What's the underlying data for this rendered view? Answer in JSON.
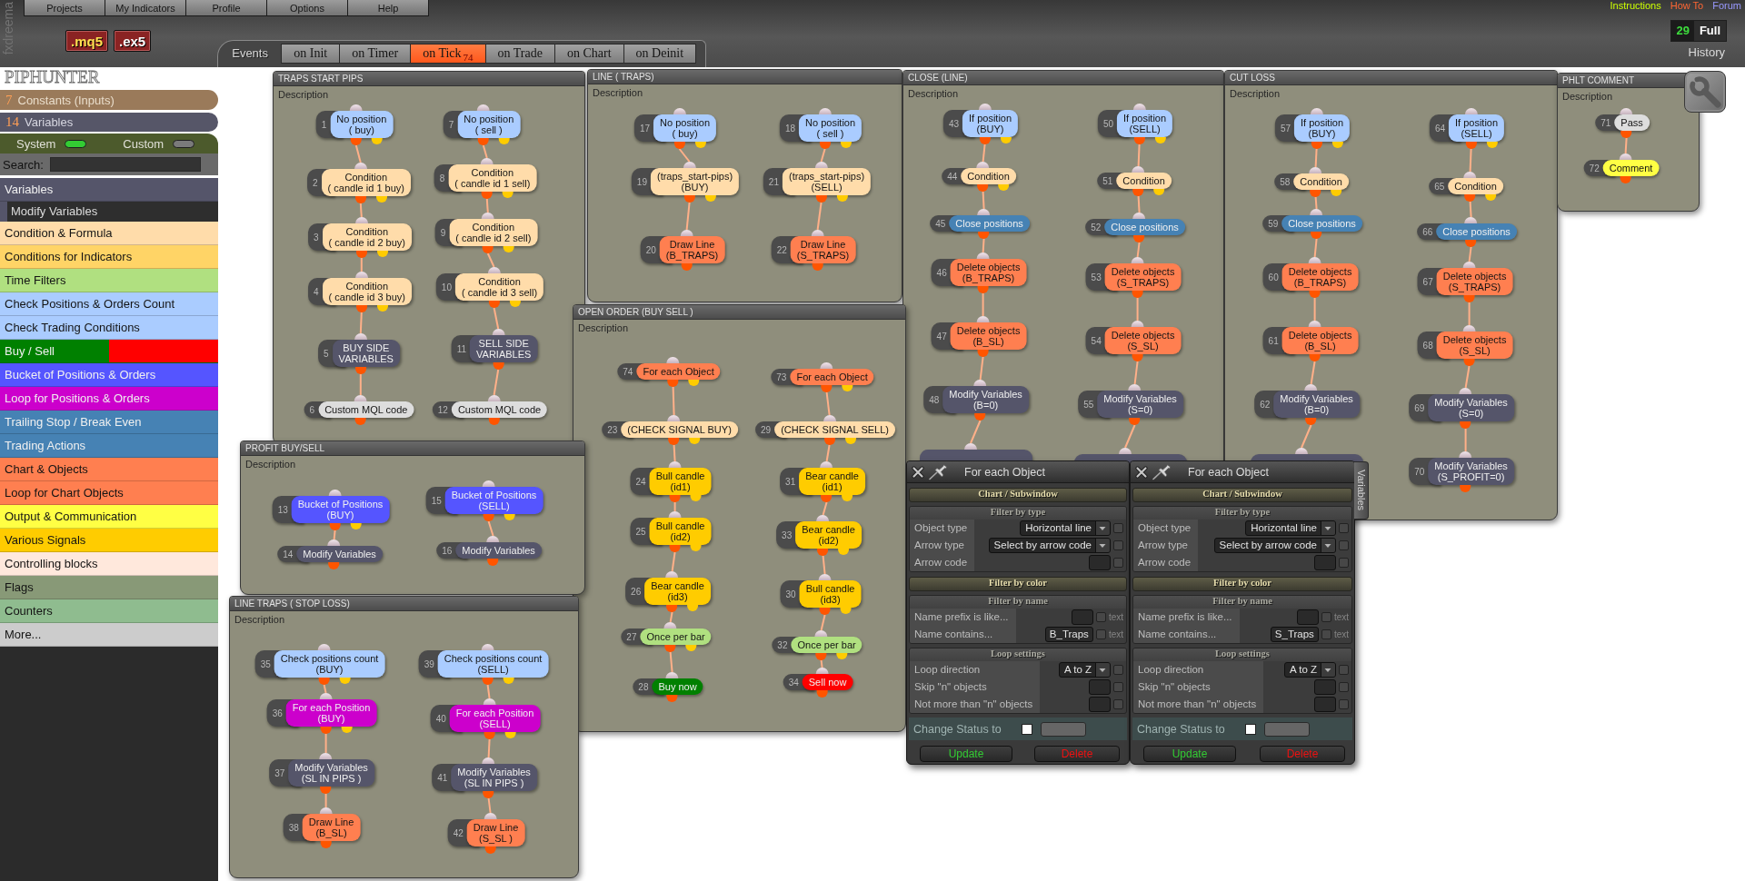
{
  "brand": "fxdreema",
  "menu": [
    "Projects",
    "My Indicators",
    "Profile",
    "Options",
    "Help"
  ],
  "export_buttons": [
    {
      "label": ".mq5",
      "kind": "source"
    },
    {
      "label": ".ex5",
      "kind": "compiled"
    }
  ],
  "events": {
    "label": "Events",
    "tabs": [
      {
        "label": "on Init",
        "selected": false
      },
      {
        "label": "on Timer",
        "selected": false
      },
      {
        "label": "on Tick",
        "count": "74",
        "selected": true
      },
      {
        "label": "on Trade",
        "selected": false
      },
      {
        "label": "on Chart",
        "selected": false
      },
      {
        "label": "on Deinit",
        "selected": false
      }
    ]
  },
  "links": [
    {
      "label": "Instructions",
      "color": "#ccff00"
    },
    {
      "label": "How To",
      "color": "#ff6633"
    },
    {
      "label": "Forum",
      "color": "#9999ff"
    }
  ],
  "block_counter": {
    "count": "29",
    "label": "Full"
  },
  "history": "History",
  "sidebar": {
    "project": "PIPHUNTER",
    "constants": {
      "count": "7",
      "label": "Constants (Inputs)"
    },
    "variables": {
      "count": "14",
      "label": "Variables"
    },
    "toggles": [
      {
        "label": "System",
        "on": true
      },
      {
        "label": "Custom",
        "on": false
      }
    ],
    "search": {
      "label": "Search:"
    },
    "categories": [
      {
        "label": "Variables",
        "color": "#55556a",
        "children": [
          {
            "label": "Modify Variables"
          }
        ]
      },
      {
        "label": "Condition & Formula",
        "color": "#ffdcaa"
      },
      {
        "label": "Conditions for Indicators",
        "color": "#ffd466"
      },
      {
        "label": "Time Filters",
        "color": "#b0e080"
      },
      {
        "label": "Check Positions & Orders Count",
        "color": "#aaccff"
      },
      {
        "label": "Check Trading Conditions",
        "color": "#aaccff"
      },
      {
        "label": "Buy / Sell",
        "color": "#008000",
        "split": {
          "color": "#ff0000"
        }
      },
      {
        "label": "Bucket of Positions & Orders",
        "color": "#5555ff"
      },
      {
        "label": "Loop for Positions & Orders",
        "color": "#cc00cc"
      },
      {
        "label": "Trailing Stop / Break Even",
        "color": "#4682b4"
      },
      {
        "label": "Trading Actions",
        "color": "#4682b4"
      },
      {
        "label": "Chart & Objects",
        "color": "#ff7f50"
      },
      {
        "label": "Loop for Chart Objects",
        "color": "#ff7f50"
      },
      {
        "label": "Output & Communication",
        "color": "#ffff44"
      },
      {
        "label": "Various Signals",
        "color": "#ffcc00"
      },
      {
        "label": "Controlling blocks",
        "color": "#ffe8dc"
      },
      {
        "label": "Flags",
        "color": "#889977"
      },
      {
        "label": "Counters",
        "color": "#8fbc8f"
      },
      {
        "label": "More...",
        "color": "#cccccc"
      }
    ]
  },
  "canvas": {
    "panels": [
      {
        "title": "TRAPS START PIPS",
        "description": "Description",
        "columns": [
          [
            {
              "number": "1",
              "label": "No position\n( buy)",
              "kind": "condition",
              "color": "#aaccff"
            },
            {
              "number": "2",
              "label": "Condition\n( candle id 1 buy)",
              "kind": "condition",
              "color": "#ffdcaa"
            },
            {
              "number": "3",
              "label": "Condition\n( candle id 2 buy)",
              "kind": "condition",
              "color": "#ffdcaa"
            },
            {
              "number": "4",
              "label": "Condition\n( candle id 3 buy)",
              "kind": "condition",
              "color": "#ffdcaa"
            },
            {
              "number": "5",
              "label": "BUY SIDE\nVARIABLES",
              "kind": "action",
              "color": "#55556a"
            },
            {
              "number": "6",
              "label": "Custom MQL code",
              "kind": "action",
              "color": "#dddddd"
            }
          ],
          [
            {
              "number": "7",
              "label": "No position\n( sell )",
              "kind": "condition",
              "color": "#aaccff"
            },
            {
              "number": "8",
              "label": "Condition\n( candle id 1 sell)",
              "kind": "condition",
              "color": "#ffdcaa"
            },
            {
              "number": "9",
              "label": "Condition\n( candle id 2 sell)",
              "kind": "condition",
              "color": "#ffdcaa"
            },
            {
              "number": "10",
              "label": "Condition\n( candle id 3 sell)",
              "kind": "condition",
              "color": "#ffdcaa"
            },
            {
              "number": "11",
              "label": "SELL SIDE\nVARIABLES",
              "kind": "action",
              "color": "#55556a"
            },
            {
              "number": "12",
              "label": "Custom MQL code",
              "kind": "action",
              "color": "#dddddd"
            }
          ]
        ]
      },
      {
        "title": "PROFIT BUY/SELL",
        "description": "Description",
        "columns": [
          [
            {
              "number": "13",
              "label": "Bucket of Positions\n(BUY)",
              "kind": "condition",
              "color": "#5555ff"
            },
            {
              "number": "14",
              "label": "Modify Variables",
              "kind": "action",
              "color": "#55556a"
            }
          ],
          [
            {
              "number": "15",
              "label": "Bucket of Positions\n(SELL)",
              "kind": "condition",
              "color": "#5555ff"
            },
            {
              "number": "16",
              "label": "Modify Variables",
              "kind": "action",
              "color": "#55556a"
            }
          ]
        ]
      },
      {
        "title": "LINE TRAPS ( STOP LOSS)",
        "description": "Description",
        "columns": [
          [
            {
              "number": "35",
              "label": "Check positions count\n(BUY)",
              "kind": "condition",
              "color": "#aaccff"
            },
            {
              "number": "36",
              "label": "For each Position\n(BUY)",
              "kind": "condition",
              "color": "#cc00cc"
            },
            {
              "number": "37",
              "label": "Modify Variables\n(SL IN PIPS )",
              "kind": "action",
              "color": "#55556a"
            },
            {
              "number": "38",
              "label": "Draw Line\n(B_SL)",
              "kind": "action",
              "color": "#ff7f50"
            }
          ],
          [
            {
              "number": "39",
              "label": "Check positions count\n(SELL)",
              "kind": "condition",
              "color": "#aaccff"
            },
            {
              "number": "40",
              "label": "For each Position\n(SELL)",
              "kind": "condition",
              "color": "#cc00cc"
            },
            {
              "number": "41",
              "label": "Modify Variables\n(SL IN PIPS )",
              "kind": "action",
              "color": "#55556a"
            },
            {
              "number": "42",
              "label": "Draw Line\n(S_SL )",
              "kind": "action",
              "color": "#ff7f50"
            }
          ]
        ]
      },
      {
        "title": "LINE ( TRAPS)",
        "description": "Description",
        "columns": [
          [
            {
              "number": "17",
              "label": "No position\n( buy)",
              "kind": "condition",
              "color": "#aaccff"
            },
            {
              "number": "19",
              "label": "(traps_start-pips)\n(BUY)",
              "kind": "condition",
              "color": "#ffdcaa"
            },
            {
              "number": "20",
              "label": "Draw Line\n(B_TRAPS)",
              "kind": "action",
              "color": "#ff7f50"
            }
          ],
          [
            {
              "number": "18",
              "label": "No position\n( sell )",
              "kind": "condition",
              "color": "#aaccff"
            },
            {
              "number": "21",
              "label": "(traps_start-pips)\n(SELL)",
              "kind": "condition",
              "color": "#ffdcaa"
            },
            {
              "number": "22",
              "label": "Draw Line\n(S_TRAPS)",
              "kind": "action",
              "color": "#ff7f50"
            }
          ]
        ]
      },
      {
        "title": "OPEN ORDER (BUY SELL )",
        "description": "Description",
        "columns": [
          [
            {
              "number": "74",
              "label": "For each Object",
              "kind": "condition",
              "color": "#ff7f50"
            },
            {
              "number": "23",
              "label": "(CHECK SIGNAL BUY)",
              "kind": "condition",
              "color": "#ffdcaa"
            },
            {
              "number": "24",
              "label": "Bull candle\n(id1)",
              "kind": "condition",
              "color": "#ffcc00"
            },
            {
              "number": "25",
              "label": "Bull candle\n(id2)",
              "kind": "condition",
              "color": "#ffcc00"
            },
            {
              "number": "26",
              "label": "Bear candle\n(id3)",
              "kind": "condition",
              "color": "#ffcc00"
            },
            {
              "number": "27",
              "label": "Once per bar",
              "kind": "condition",
              "color": "#b0e080"
            },
            {
              "number": "28",
              "label": "Buy now",
              "kind": "action",
              "color": "#008000"
            }
          ],
          [
            {
              "number": "73",
              "label": "For each Object",
              "kind": "condition",
              "color": "#ff7f50"
            },
            {
              "number": "29",
              "label": "(CHECK SIGNAL SELL)",
              "kind": "condition",
              "color": "#ffdcaa"
            },
            {
              "number": "31",
              "label": "Bear candle\n(id1)",
              "kind": "condition",
              "color": "#ffcc00"
            },
            {
              "number": "33",
              "label": "Bear candle\n(id2)",
              "kind": "condition",
              "color": "#ffcc00"
            },
            {
              "number": "30",
              "label": "Bull candle\n(id3)",
              "kind": "condition",
              "color": "#ffcc00"
            },
            {
              "number": "32",
              "label": "Once per bar",
              "kind": "condition",
              "color": "#b0e080"
            },
            {
              "number": "34",
              "label": "Sell now",
              "kind": "action",
              "color": "#ff0000"
            }
          ]
        ]
      },
      {
        "title": "CLOSE (LINE)",
        "description": "Description",
        "columns": [
          [
            {
              "number": "43",
              "label": "If position\n(BUY)",
              "kind": "condition",
              "color": "#aaccff"
            },
            {
              "number": "44",
              "label": "Condition",
              "kind": "condition",
              "color": "#ffdcaa"
            },
            {
              "number": "45",
              "label": "Close positions",
              "kind": "action",
              "color": "#4682b4"
            },
            {
              "number": "46",
              "label": "Delete objects\n(B_TRAPS)",
              "kind": "action",
              "color": "#ff7f50"
            },
            {
              "number": "47",
              "label": "Delete objects\n(B_SL)",
              "kind": "action",
              "color": "#ff7f50"
            },
            {
              "number": "48",
              "label": "Modify Variables\n(B=0)",
              "kind": "action",
              "color": "#55556a"
            },
            {
              "kind": "action",
              "color": "#55556a"
            }
          ],
          [
            {
              "number": "50",
              "label": "If position\n(SELL)",
              "kind": "condition",
              "color": "#aaccff"
            },
            {
              "number": "51",
              "label": "Condition",
              "kind": "condition",
              "color": "#ffdcaa"
            },
            {
              "number": "52",
              "label": "Close positions",
              "kind": "action",
              "color": "#4682b4"
            },
            {
              "number": "53",
              "label": "Delete objects\n(S_TRAPS)",
              "kind": "action",
              "color": "#ff7f50"
            },
            {
              "number": "54",
              "label": "Delete objects\n(S_SL)",
              "kind": "action",
              "color": "#ff7f50"
            },
            {
              "number": "55",
              "label": "Modify Variables\n(S=0)",
              "kind": "action",
              "color": "#55556a"
            },
            {
              "kind": "action",
              "color": "#55556a"
            }
          ]
        ]
      },
      {
        "title": "CUT LOSS",
        "description": "Description",
        "columns": [
          [
            {
              "number": "57",
              "label": "If position\n(BUY)",
              "kind": "condition",
              "color": "#aaccff"
            },
            {
              "number": "58",
              "label": "Condition",
              "kind": "condition",
              "color": "#ffdcaa"
            },
            {
              "number": "59",
              "label": "Close positions",
              "kind": "action",
              "color": "#4682b4"
            },
            {
              "number": "60",
              "label": "Delete objects\n(B_TRAPS)",
              "kind": "action",
              "color": "#ff7f50"
            },
            {
              "number": "61",
              "label": "Delete objects\n(B_SL)",
              "kind": "action",
              "color": "#ff7f50"
            },
            {
              "number": "62",
              "label": "Modify Variables\n(B=0)",
              "kind": "action",
              "color": "#55556a"
            },
            {
              "kind": "action",
              "color": "#55556a"
            }
          ],
          [
            {
              "number": "64",
              "label": "If position\n(SELL)",
              "kind": "condition",
              "color": "#aaccff"
            },
            {
              "number": "65",
              "label": "Condition",
              "kind": "condition",
              "color": "#ffdcaa"
            },
            {
              "number": "66",
              "label": "Close positions",
              "kind": "action",
              "color": "#4682b4"
            },
            {
              "number": "67",
              "label": "Delete objects\n(S_TRAPS)",
              "kind": "action",
              "color": "#ff7f50"
            },
            {
              "number": "68",
              "label": "Delete objects\n(S_SL)",
              "kind": "action",
              "color": "#ff7f50"
            },
            {
              "number": "69",
              "label": "Modify Variables\n(S=0)",
              "kind": "action",
              "color": "#55556a"
            },
            {
              "number": "70",
              "label": "Modify Variables\n(S_PROFIT=0)",
              "kind": "action",
              "color": "#55556a"
            }
          ]
        ]
      },
      {
        "title": "PHLT COMMENT",
        "description": "Description",
        "columns": [
          [
            {
              "number": "71",
              "label": "Pass",
              "kind": "action",
              "color": "#dddddd"
            },
            {
              "number": "72",
              "label": "Comment",
              "kind": "action",
              "color": "#ffff44"
            }
          ]
        ]
      }
    ],
    "dialogs": [
      {
        "title": "For each Object",
        "sections": [
          {
            "title": "Chart / Subwindow",
            "expanded": false
          },
          {
            "title": "Filter by type",
            "expanded": true,
            "rows": [
              {
                "label": "Object type",
                "kind": "select",
                "value": "Horizontal line",
                "checked": false
              },
              {
                "label": "Arrow type",
                "kind": "select",
                "value": "Select by arrow code",
                "checked": false
              },
              {
                "label": "Arrow code",
                "kind": "input",
                "checked": false
              }
            ]
          },
          {
            "title": "Filter by color",
            "expanded": false
          },
          {
            "title": "Filter by name",
            "expanded": true,
            "rows": [
              {
                "label": "Name prefix is like...",
                "kind": "input",
                "checked": false,
                "suffix": "text"
              },
              {
                "label": "Name contains...",
                "kind": "input",
                "value": "B_Traps",
                "checked": false,
                "suffix": "text"
              }
            ]
          },
          {
            "title": "Loop settings",
            "expanded": true,
            "rows": [
              {
                "label": "Loop direction",
                "kind": "select",
                "value": "A to Z",
                "checked": false
              },
              {
                "label": "Skip \"n\" objects",
                "kind": "input",
                "checked": false
              },
              {
                "label": "Not more than \"n\" objects",
                "kind": "input",
                "checked": false
              }
            ]
          }
        ],
        "status": {
          "label": "Change Status to",
          "checked": false
        },
        "buttons": [
          {
            "label": "Update",
            "kind": "update"
          },
          {
            "label": "Delete",
            "kind": "delete"
          }
        ]
      },
      {
        "title": "For each Object",
        "sections": [
          {
            "title": "Chart / Subwindow",
            "expanded": false
          },
          {
            "title": "Filter by type",
            "expanded": true,
            "rows": [
              {
                "label": "Object type",
                "kind": "select",
                "value": "Horizontal line",
                "checked": false
              },
              {
                "label": "Arrow type",
                "kind": "select",
                "value": "Select by arrow code",
                "checked": false
              },
              {
                "label": "Arrow code",
                "kind": "input",
                "checked": false
              }
            ]
          },
          {
            "title": "Filter by color",
            "expanded": false
          },
          {
            "title": "Filter by name",
            "expanded": true,
            "rows": [
              {
                "label": "Name prefix is like...",
                "kind": "input",
                "checked": false,
                "suffix": "text"
              },
              {
                "label": "Name contains...",
                "kind": "input",
                "value": "S_Traps",
                "checked": false,
                "suffix": "text"
              }
            ]
          },
          {
            "title": "Loop settings",
            "expanded": true,
            "rows": [
              {
                "label": "Loop direction",
                "kind": "select",
                "value": "A to Z",
                "checked": false
              },
              {
                "label": "Skip \"n\" objects",
                "kind": "input",
                "checked": false
              },
              {
                "label": "Not more than \"n\" objects",
                "kind": "input",
                "checked": false
              }
            ]
          }
        ],
        "status": {
          "label": "Change Status to",
          "checked": false
        },
        "buttons": [
          {
            "label": "Update",
            "kind": "update"
          },
          {
            "label": "Delete",
            "kind": "delete"
          }
        ]
      }
    ],
    "side_tab": "Variables"
  }
}
